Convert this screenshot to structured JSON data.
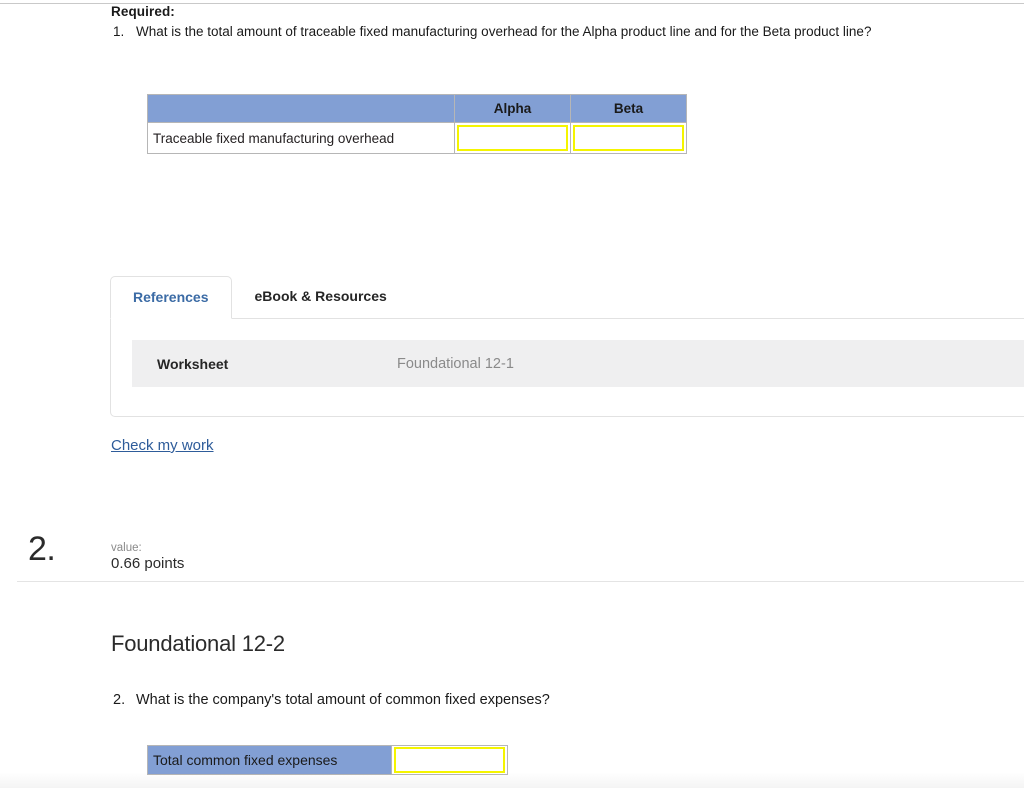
{
  "question1": {
    "required_label": "Required:",
    "items": [
      {
        "number": "1.",
        "text": "What is the total amount of traceable fixed manufacturing overhead for the Alpha product line and for the Beta product line?"
      }
    ],
    "table": {
      "headers": [
        "",
        "Alpha",
        "Beta"
      ],
      "rows": [
        {
          "label": "Traceable fixed manufacturing overhead",
          "values": [
            "",
            ""
          ]
        }
      ]
    }
  },
  "tabs": [
    {
      "label": "References",
      "active": true
    },
    {
      "label": "eBook & Resources",
      "active": false
    }
  ],
  "tab_panel": {
    "worksheet_label": "Worksheet",
    "worksheet_reference": "Foundational 12-1"
  },
  "check_my_work": "Check my work",
  "question2": {
    "number": "2.",
    "value_label": "value:",
    "value_points": "0.66 points",
    "heading": "Foundational 12-2",
    "items": [
      {
        "number": "2.",
        "text": "What is the company's total amount of common fixed expenses?"
      }
    ],
    "table": {
      "rows": [
        {
          "label": "Total common fixed expenses",
          "values": [
            ""
          ]
        }
      ]
    }
  },
  "colors": {
    "header_blue": "#829fd4",
    "input_yellow": "#f5f500",
    "link_blue": "#2e5c9a",
    "active_tab_blue": "#3b6ba5",
    "band_gray": "#efeff0",
    "muted_gray": "#8a8a8a"
  }
}
